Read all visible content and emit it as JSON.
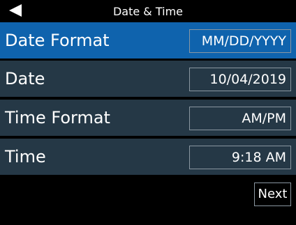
{
  "header": {
    "title": "Date & Time",
    "back_icon": "back-triangle-icon"
  },
  "colors": {
    "selected_row": "#0f63ad",
    "row": "#253846",
    "background": "#000000",
    "text": "#ffffff",
    "field_border": "#8a97a1"
  },
  "settings": [
    {
      "label": "Date Format",
      "value": "MM/DD/YYYY",
      "selected": true
    },
    {
      "label": "Date",
      "value": "10/04/2019",
      "selected": false
    },
    {
      "label": "Time Format",
      "value": "AM/PM",
      "selected": false
    },
    {
      "label": "Time",
      "value": "9:18 AM",
      "selected": false
    }
  ],
  "footer": {
    "next_label": "Next"
  }
}
